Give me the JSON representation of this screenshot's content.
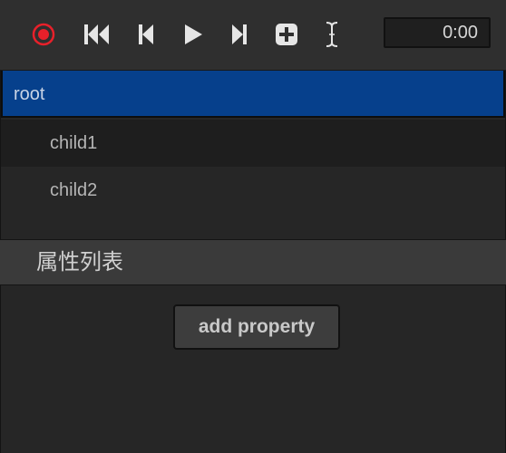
{
  "toolbar": {
    "record_icon": "record-icon",
    "first_icon": "skip-to-start-icon",
    "prev_icon": "step-back-icon",
    "play_icon": "play-icon",
    "next_icon": "step-forward-icon",
    "add_icon": "add-keyframe-icon",
    "cursor_icon": "text-cursor-icon",
    "timecode": "0:00",
    "record_color": "#e8202a"
  },
  "tree": {
    "items": [
      {
        "label": "root",
        "selected": true
      },
      {
        "label": "child1",
        "selected": false
      },
      {
        "label": "child2",
        "selected": false
      }
    ],
    "selected_color": "#06408c"
  },
  "properties": {
    "header": "属性列表",
    "add_button_label": "add property"
  }
}
